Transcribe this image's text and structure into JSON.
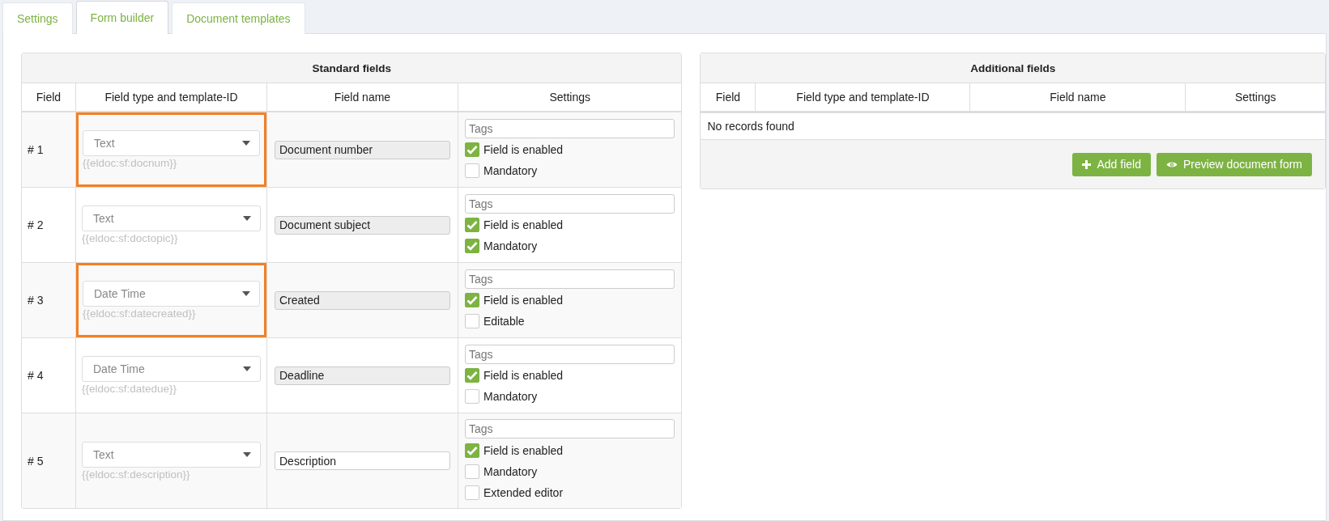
{
  "tabs": [
    {
      "label": "Settings",
      "selected": false
    },
    {
      "label": "Form builder",
      "selected": true
    },
    {
      "label": "Document templates",
      "selected": false
    }
  ],
  "standard_fields": {
    "title": "Standard fields",
    "columns": [
      "Field",
      "Field type and template-ID",
      "Field name",
      "Settings"
    ],
    "rows": [
      {
        "field": "# 1",
        "type": "Text",
        "template_id": "{{eldoc:sf:docnum}}",
        "highlighted": true,
        "name": "Document number",
        "name_disabled": true,
        "tags_placeholder": "Tags",
        "options": [
          {
            "label": "Field is enabled",
            "checked": true
          },
          {
            "label": "Mandatory",
            "checked": false
          }
        ]
      },
      {
        "field": "# 2",
        "type": "Text",
        "template_id": "{{eldoc:sf:doctopic}}",
        "highlighted": false,
        "name": "Document subject",
        "name_disabled": true,
        "tags_placeholder": "Tags",
        "options": [
          {
            "label": "Field is enabled",
            "checked": true
          },
          {
            "label": "Mandatory",
            "checked": true
          }
        ]
      },
      {
        "field": "# 3",
        "type": "Date Time",
        "template_id": "{{eldoc:sf:datecreated}}",
        "highlighted": true,
        "name": "Created",
        "name_disabled": true,
        "tags_placeholder": "Tags",
        "options": [
          {
            "label": "Field is enabled",
            "checked": true
          },
          {
            "label": "Editable",
            "checked": false
          }
        ]
      },
      {
        "field": "# 4",
        "type": "Date Time",
        "template_id": "{{eldoc:sf:datedue}}",
        "highlighted": false,
        "name": "Deadline",
        "name_disabled": true,
        "tags_placeholder": "Tags",
        "options": [
          {
            "label": "Field is enabled",
            "checked": true
          },
          {
            "label": "Mandatory",
            "checked": false
          }
        ]
      },
      {
        "field": "# 5",
        "type": "Text",
        "template_id": "{{eldoc:sf:description}}",
        "highlighted": false,
        "name": "Description",
        "name_disabled": false,
        "tags_placeholder": "Tags",
        "options": [
          {
            "label": "Field is enabled",
            "checked": true
          },
          {
            "label": "Mandatory",
            "checked": false
          },
          {
            "label": "Extended editor",
            "checked": false
          }
        ]
      }
    ]
  },
  "additional_fields": {
    "title": "Additional fields",
    "columns": [
      "Field",
      "Field type and template-ID",
      "Field name",
      "Settings"
    ],
    "empty_message": "No records found",
    "buttons": [
      {
        "label": "Add field",
        "kind": "add"
      },
      {
        "label": "Preview document form",
        "kind": "preview"
      }
    ]
  }
}
